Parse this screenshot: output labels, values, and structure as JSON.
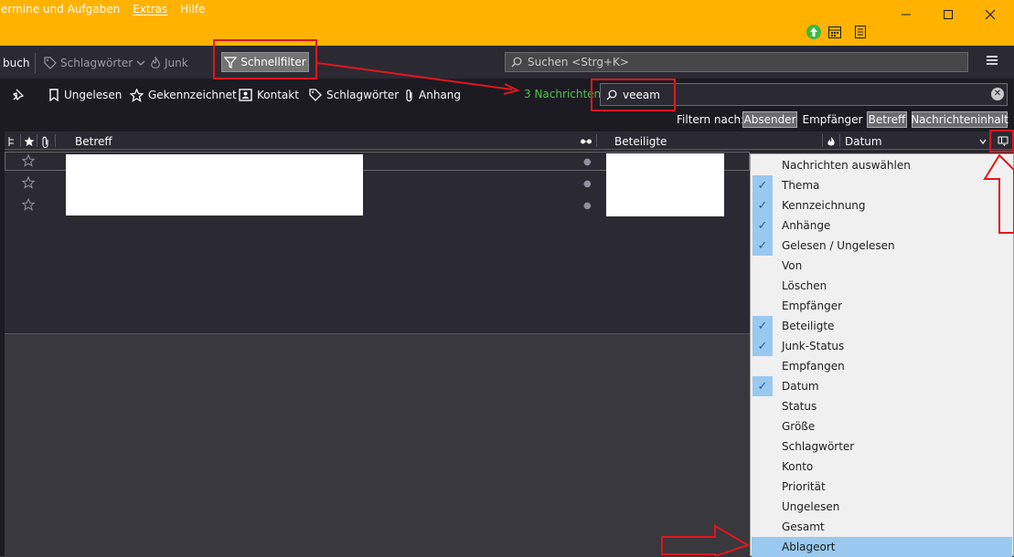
{
  "menu": {
    "items": [
      "ermine und Aufgaben",
      "Extras",
      "Hilfe"
    ]
  },
  "window": {
    "minimize_icon": "minimize-icon",
    "maximize_icon": "maximize-icon",
    "close_icon": "close-icon"
  },
  "toolbar": {
    "addressbook_label": "buch",
    "tags_label": "Schlagwörter",
    "junk_label": "Junk",
    "quickfilter_label": "Schnellfilter",
    "search_placeholder": "Suchen <Strg+K>"
  },
  "quickfilter": {
    "unread_label": "Ungelesen",
    "starred_label": "Gekennzeichnet",
    "contact_label": "Kontakt",
    "tags_label": "Schlagwörter",
    "attachment_label": "Anhang",
    "count_text": "3 Nachrichten",
    "search_value": "veeam",
    "filter_by_label": "Filtern nach:",
    "filter_options": [
      {
        "label": "Absender",
        "active": true
      },
      {
        "label": "Empfänger",
        "active": false
      },
      {
        "label": "Betreff",
        "active": true
      },
      {
        "label": "Nachrichteninhalt",
        "active": true
      }
    ]
  },
  "columns": {
    "subject": "Betreff",
    "correspondents": "Beteiligte",
    "date": "Datum"
  },
  "column_picker": {
    "items": [
      {
        "label": "Nachrichten auswählen",
        "checked": false
      },
      {
        "label": "Thema",
        "checked": true
      },
      {
        "label": "Kennzeichnung",
        "checked": true
      },
      {
        "label": "Anhänge",
        "checked": true
      },
      {
        "label": "Gelesen / Ungelesen",
        "checked": true
      },
      {
        "label": "Von",
        "checked": false
      },
      {
        "label": "Löschen",
        "checked": false
      },
      {
        "label": "Empfänger",
        "checked": false
      },
      {
        "label": "Beteiligte",
        "checked": true
      },
      {
        "label": "Junk-Status",
        "checked": true
      },
      {
        "label": "Empfangen",
        "checked": false
      },
      {
        "label": "Datum",
        "checked": true
      },
      {
        "label": "Status",
        "checked": false
      },
      {
        "label": "Größe",
        "checked": false
      },
      {
        "label": "Schlagwörter",
        "checked": false
      },
      {
        "label": "Konto",
        "checked": false
      },
      {
        "label": "Priorität",
        "checked": false
      },
      {
        "label": "Ungelesen",
        "checked": false
      },
      {
        "label": "Gesamt",
        "checked": false
      },
      {
        "label": "Ablageort",
        "checked": false,
        "highlighted": true
      }
    ]
  },
  "colors": {
    "titlebar": "#ffb300",
    "count_green": "#4fc34b",
    "annotation_red": "#e0161e",
    "menu_highlight": "#99c9ef"
  }
}
